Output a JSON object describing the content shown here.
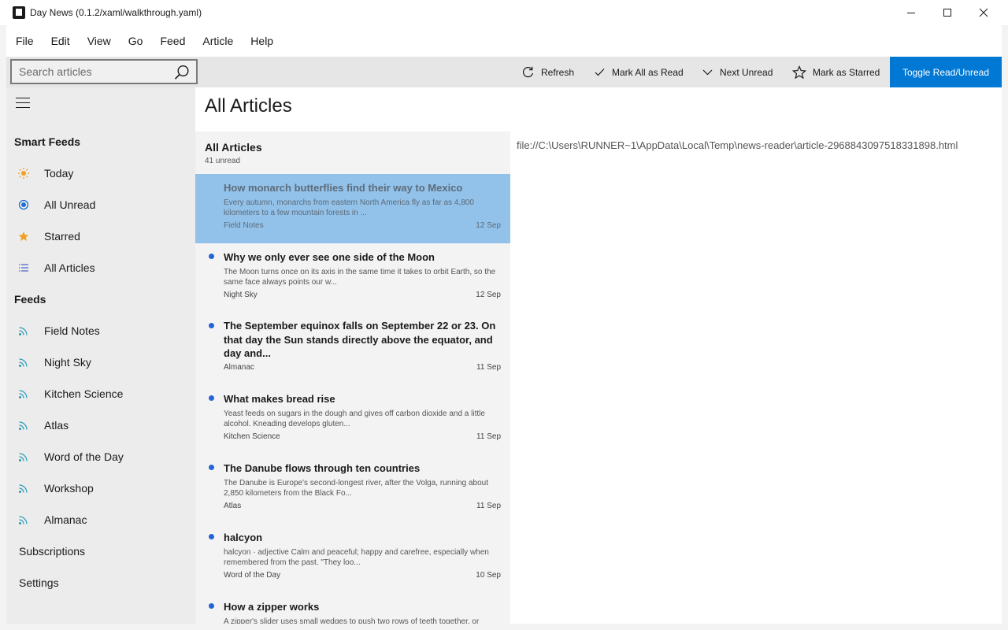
{
  "window": {
    "title": "Day News (0.1.2/xaml/walkthrough.yaml)"
  },
  "menu": [
    "File",
    "Edit",
    "View",
    "Go",
    "Feed",
    "Article",
    "Help"
  ],
  "search": {
    "placeholder": "Search articles",
    "value": ""
  },
  "toolbar": {
    "refresh": "Refresh",
    "mark_all": "Mark All as Read",
    "next_unread": "Next Unread",
    "mark_starred": "Mark as Starred",
    "toggle": "Toggle Read/Unread"
  },
  "sidebar": {
    "smart_feeds_label": "Smart Feeds",
    "smart_feeds": [
      {
        "label": "Today",
        "icon": "sun-icon"
      },
      {
        "label": "All Unread",
        "icon": "radio-icon"
      },
      {
        "label": "Starred",
        "icon": "star-icon"
      },
      {
        "label": "All Articles",
        "icon": "list-icon"
      }
    ],
    "feeds_label": "Feeds",
    "feeds": [
      "Field Notes",
      "Night Sky",
      "Kitchen Science",
      "Atlas",
      "Word of the Day",
      "Workshop",
      "Almanac"
    ],
    "subscriptions": "Subscriptions",
    "settings": "Settings"
  },
  "main": {
    "title": "All Articles",
    "list_title": "All Articles",
    "unread_count": "41 unread",
    "path": "file://C:\\Users\\RUNNER~1\\AppData\\Local\\Temp\\news-reader\\article-2968843097518331898.html"
  },
  "articles": [
    {
      "title": "How monarch butterflies find their way to Mexico",
      "snippet": "Every autumn, monarchs from eastern North America fly as far as 4,800 kilometers to a few mountain forests in ...",
      "feed": "Field Notes",
      "date": "12 Sep",
      "unread": false,
      "selected": true
    },
    {
      "title": "Why we only ever see one side of the Moon",
      "snippet": "The Moon turns once on its axis in the same time it takes to orbit Earth, so the same face always points our w...",
      "feed": "Night Sky",
      "date": "12 Sep",
      "unread": true,
      "selected": false
    },
    {
      "title": "The September equinox falls on September 22 or 23. On that day the Sun stands directly above the equator, and day and...",
      "snippet": "",
      "feed": "Almanac",
      "date": "11 Sep",
      "unread": true,
      "selected": false
    },
    {
      "title": "What makes bread rise",
      "snippet": "Yeast feeds on sugars in the dough and gives off carbon dioxide and a little alcohol. Kneading develops gluten...",
      "feed": "Kitchen Science",
      "date": "11 Sep",
      "unread": true,
      "selected": false
    },
    {
      "title": "The Danube flows through ten countries",
      "snippet": "The Danube is Europe's second-longest river, after the Volga, running about 2,850 kilometers from the Black Fo...",
      "feed": "Atlas",
      "date": "11 Sep",
      "unread": true,
      "selected": false
    },
    {
      "title": "halcyon",
      "snippet": "halcyon · adjective Calm and peaceful; happy and carefree, especially when remembered from the past. \"They loo...",
      "feed": "Word of the Day",
      "date": "10 Sep",
      "unread": true,
      "selected": false
    },
    {
      "title": "How a zipper works",
      "snippet": "A zipper's slider uses small wedges to push two rows of teeth together, or",
      "feed": "",
      "date": "",
      "unread": true,
      "selected": false
    }
  ]
}
